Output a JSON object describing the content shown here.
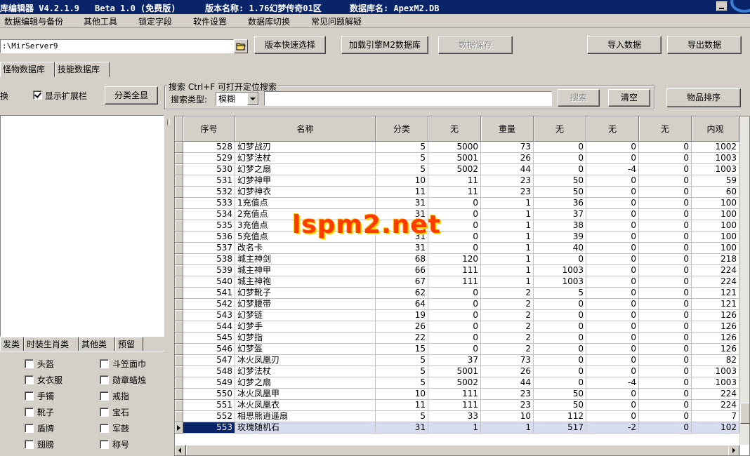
{
  "titlebar": {
    "app": "库编辑器 V4.2.1.9",
    "beta": "Beta 1.0 (免费版)",
    "version": "版本名称: 1.76幻梦传奇01区",
    "db": "数据库名: ApexM2.DB"
  },
  "menu": [
    "数据编辑与备份",
    "其他工具",
    "锁定字段",
    "软件设置",
    "数据库切换",
    "常见问题解疑"
  ],
  "toolbar": {
    "path_value": ":\\MirServer9",
    "version_select_label": "版本快速选择",
    "load_engine_label": "加载引擎M2数据库",
    "save_label": "数据保存",
    "import_label": "导入数据",
    "export_label": "导出数据"
  },
  "db_tabs": [
    "怪物数据库",
    "技能数据库"
  ],
  "left": {
    "switch_label": "换",
    "show_ext_label": "显示扩展栏",
    "show_all_label": "分类全显"
  },
  "search": {
    "group_title": "搜索  Ctrl+F 可打开定位搜索",
    "type_label": "搜索类型:",
    "type_value": "模糊",
    "search_btn": "搜索",
    "clear_btn": "清空",
    "sort_btn": "物品排序"
  },
  "category_tabs": [
    "发类",
    "时装生肖类",
    "其他类",
    "预留"
  ],
  "categories": [
    [
      "头盔",
      "斗笠面巾"
    ],
    [
      "女衣服",
      "勋章蜡烛"
    ],
    [
      "手镯",
      "戒指"
    ],
    [
      "靴子",
      "宝石"
    ],
    [
      "盾牌",
      "军鼓"
    ],
    [
      "翅膀",
      "称号"
    ]
  ],
  "grid": {
    "columns": [
      "序号",
      "名称",
      "分类",
      "无",
      "重量",
      "无",
      "无",
      "无",
      "内观"
    ],
    "rows": [
      [
        "528",
        "幻梦战刃",
        "5",
        "5000",
        "73",
        "0",
        "0",
        "0",
        "1002"
      ],
      [
        "529",
        "幻梦法杖",
        "5",
        "5001",
        "26",
        "0",
        "0",
        "0",
        "1003"
      ],
      [
        "530",
        "幻梦之扇",
        "5",
        "5002",
        "44",
        "0",
        "-4",
        "0",
        "1003"
      ],
      [
        "531",
        "幻梦神甲",
        "10",
        "11",
        "23",
        "50",
        "0",
        "0",
        "59"
      ],
      [
        "532",
        "幻梦神衣",
        "11",
        "11",
        "23",
        "50",
        "0",
        "0",
        "60"
      ],
      [
        "533",
        "1充值点",
        "31",
        "0",
        "1",
        "36",
        "0",
        "0",
        "100"
      ],
      [
        "534",
        "2充值点",
        "31",
        "0",
        "1",
        "37",
        "0",
        "0",
        "100"
      ],
      [
        "535",
        "3充值点",
        "31",
        "0",
        "1",
        "38",
        "0",
        "0",
        "100"
      ],
      [
        "536",
        "5充值点",
        "31",
        "0",
        "1",
        "39",
        "0",
        "0",
        "100"
      ],
      [
        "537",
        "改名卡",
        "31",
        "0",
        "1",
        "40",
        "0",
        "0",
        "100"
      ],
      [
        "538",
        "城主神剑",
        "68",
        "120",
        "1",
        "0",
        "0",
        "0",
        "218"
      ],
      [
        "539",
        "城主神甲",
        "66",
        "111",
        "1",
        "1003",
        "0",
        "0",
        "224"
      ],
      [
        "540",
        "城主神袍",
        "67",
        "111",
        "1",
        "1003",
        "0",
        "0",
        "224"
      ],
      [
        "541",
        "幻梦靴子",
        "62",
        "0",
        "2",
        "5",
        "0",
        "0",
        "121"
      ],
      [
        "542",
        "幻梦腰带",
        "64",
        "0",
        "2",
        "0",
        "0",
        "0",
        "121"
      ],
      [
        "543",
        "幻梦链",
        "19",
        "0",
        "2",
        "0",
        "0",
        "0",
        "126"
      ],
      [
        "544",
        "幻梦手",
        "26",
        "0",
        "2",
        "0",
        "0",
        "0",
        "126"
      ],
      [
        "545",
        "幻梦指",
        "22",
        "0",
        "2",
        "0",
        "0",
        "0",
        "126"
      ],
      [
        "546",
        "幻梦盔",
        "15",
        "0",
        "2",
        "0",
        "0",
        "0",
        "126"
      ],
      [
        "547",
        "冰火凤凰刃",
        "5",
        "37",
        "73",
        "0",
        "0",
        "0",
        "82"
      ],
      [
        "548",
        "幻梦法杖",
        "5",
        "5001",
        "26",
        "0",
        "0",
        "0",
        "1003"
      ],
      [
        "549",
        "幻梦之扇",
        "5",
        "5002",
        "44",
        "0",
        "-4",
        "0",
        "1003"
      ],
      [
        "550",
        "冰火凤凰甲",
        "10",
        "111",
        "23",
        "50",
        "0",
        "0",
        "224"
      ],
      [
        "551",
        "冰火凤凰衣",
        "11",
        "111",
        "23",
        "50",
        "0",
        "0",
        "224"
      ],
      [
        "552",
        "相思熊逍遥扇",
        "5",
        "33",
        "10",
        "112",
        "0",
        "0",
        "7"
      ],
      [
        "553",
        "玫瑰随机石",
        "31",
        "1",
        "1",
        "517",
        "-2",
        "0",
        "102"
      ]
    ],
    "selected_index": 25
  },
  "watermark": "lspm2.net"
}
